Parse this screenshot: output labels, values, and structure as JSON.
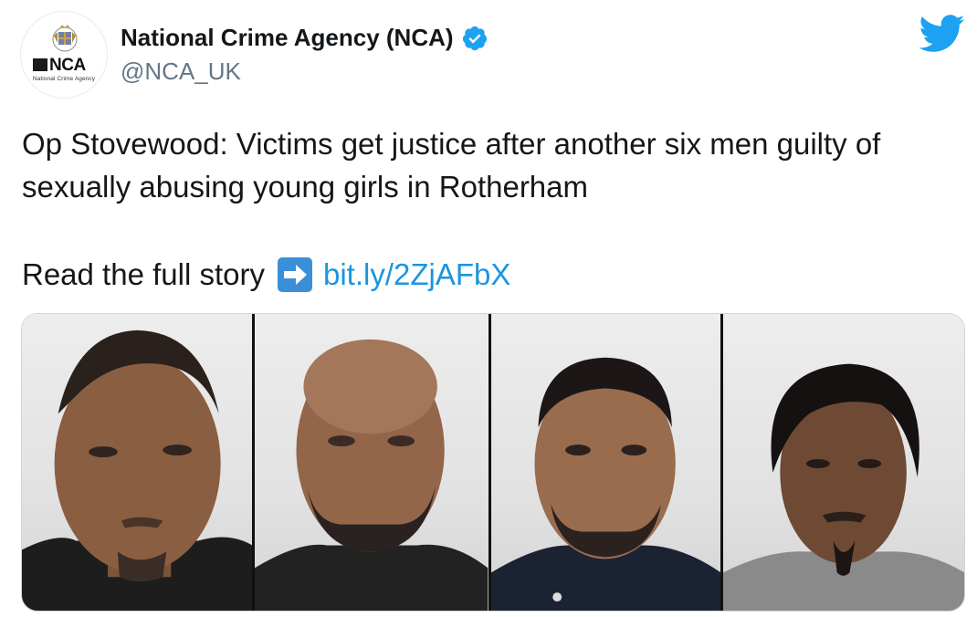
{
  "author": {
    "display_name": "National Crime Agency (NCA)",
    "handle": "@NCA_UK",
    "verified": true,
    "avatar": {
      "logo_text": "NCA",
      "logo_subtext": "National Crime Agency"
    }
  },
  "tweet": {
    "text": "Op Stovewood: Victims get justice after another six men guilty of sexually abusing young girls in Rotherham",
    "story_prefix": "Read the full story",
    "story_emoji": "right-arrow-emoji",
    "link_text": "bit.ly/2ZjAFbX"
  },
  "media": {
    "photo_count": 4
  },
  "icons": {
    "brand": "twitter-bird-icon",
    "verified": "verified-badge-icon"
  },
  "colors": {
    "twitter_blue": "#1da1f2",
    "link": "#1b95e0",
    "secondary_text": "#657786",
    "primary_text": "#14171a"
  }
}
